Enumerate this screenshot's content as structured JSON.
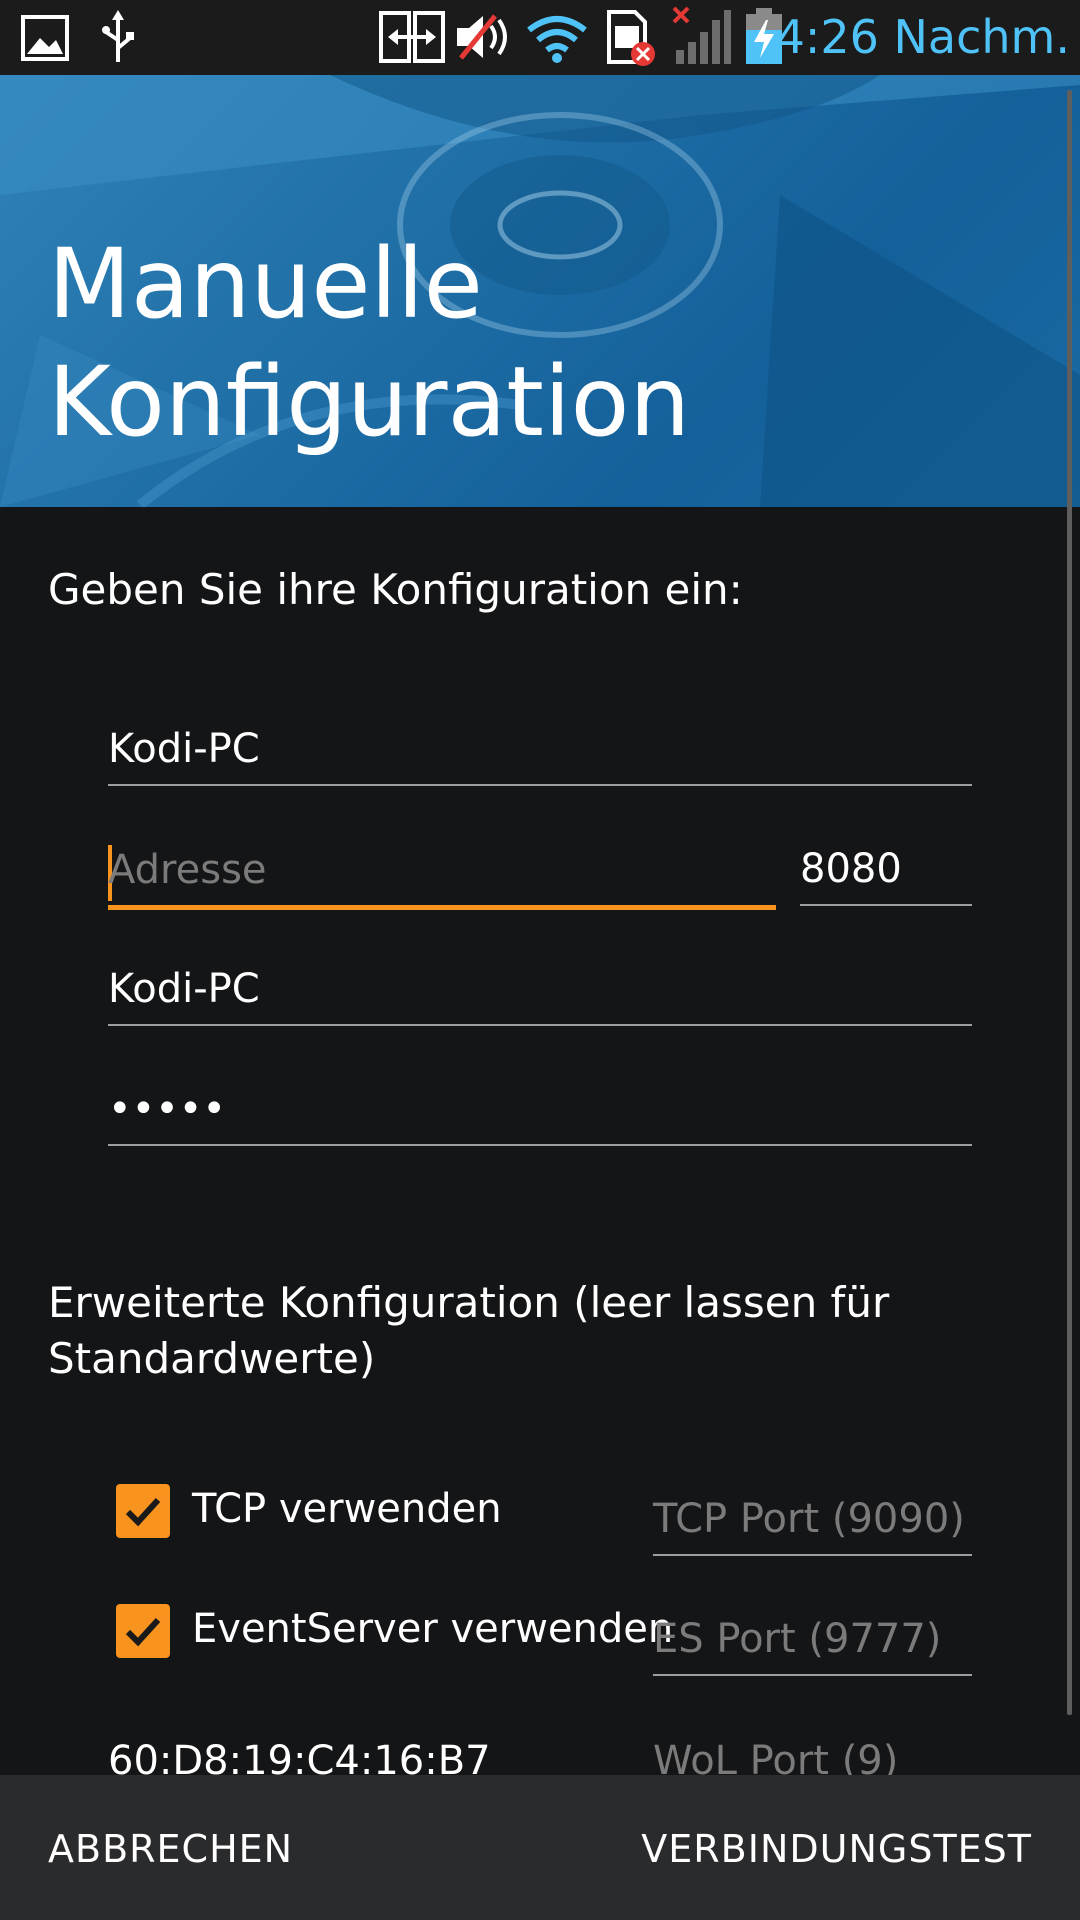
{
  "status_bar": {
    "time": "4:26 Nachm.",
    "icons": [
      "picture-icon",
      "usb-icon",
      "screen-mirror-icon",
      "muted-volume-icon",
      "wifi-icon",
      "sim-error-icon",
      "signal-off-icon",
      "battery-charging-icon"
    ]
  },
  "header": {
    "title": "Manuelle\nKonfiguration"
  },
  "config": {
    "intro": "Geben Sie ihre Konfiguration ein:",
    "name_value": "Kodi-PC",
    "address_placeholder": "Adresse",
    "port_value": "8080",
    "username_value": "Kodi-PC",
    "password_value": "•••••"
  },
  "advanced": {
    "heading": "Erweiterte Konfiguration (leer lassen für Standardwerte)",
    "tcp_label": "TCP verwenden",
    "tcp_checked": true,
    "tcp_port_placeholder": "TCP Port (9090)",
    "es_label": "EventServer verwenden",
    "es_checked": true,
    "es_port_placeholder": "ES Port (9777)",
    "mac_value": "60:D8:19:C4:16:B7",
    "wol_port_placeholder": "WoL Port (9)"
  },
  "actions": {
    "cancel_label": "ABBRECHEN",
    "test_label": "VERBINDUNGSTEST"
  },
  "colors": {
    "accent": "#f7931e",
    "background": "#141517",
    "header_blue": "#1f6ea6",
    "status_time": "#4fc3f7"
  }
}
